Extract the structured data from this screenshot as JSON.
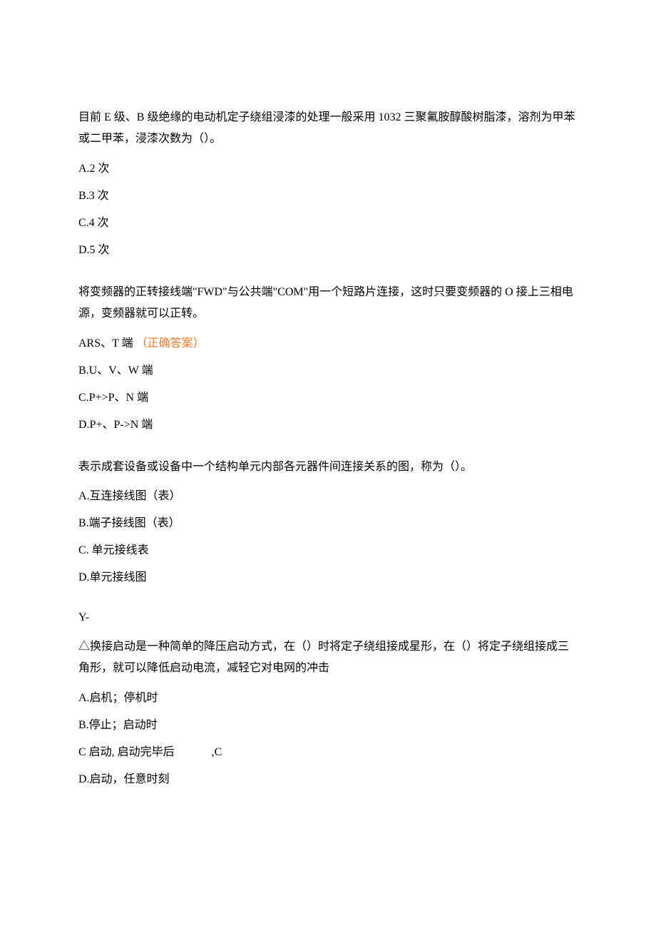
{
  "questions": [
    {
      "text": "目前 E 级、B 级绝缘的电动机定子绕组浸漆的处理一般采用 1032 三聚氟胺醇酸树脂漆，溶剂为甲苯或二甲苯，浸漆次数为（）。",
      "options": [
        "A.2 次",
        "B.3 次",
        "C.4 次",
        "D.5 次"
      ]
    },
    {
      "text": "将变频器的正转接线端\"FWD\"与公共端\"COM\"用一个短路片连接，这时只要变频器的 O 接上三相电源，变频器就可以正转。",
      "options": [
        "ARS、T 端",
        "B.U、V、W 端",
        "C.P+>P、N 端",
        "D.P+、P->N 端"
      ],
      "correct_label": "（正确答案）",
      "correct_index": 0
    },
    {
      "text": "表示成套设备或设备中一个结构单元内部各元器件间连接关系的图，称为（）。",
      "options": [
        "A.互连接线图（表）",
        "B.端子接线图（表）",
        "C. 单元接线表",
        "D.单元接线图"
      ]
    },
    {
      "prefix": "Y-",
      "text": "△换接启动是一种简单的降压启动方式，在（）时将定子绕组接成星形，在（）将定子绕组接成三角形，就可以降低启动电流，减轻它对电网的冲击",
      "options": [
        "A.启机；停机时",
        "B.停止；启动时",
        "C 启动, 启动完毕后             ,C",
        "D.启动，任意时刻"
      ]
    }
  ]
}
